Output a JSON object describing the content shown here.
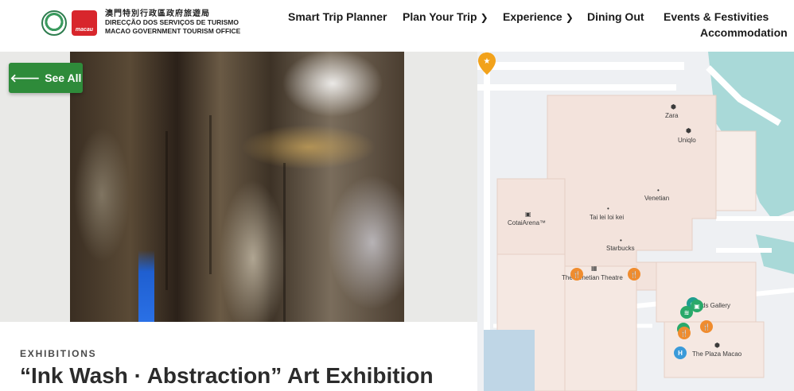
{
  "header": {
    "logo": {
      "zh_text": "澳門特別行政區政府旅遊局",
      "pt_text": "DIRECÇÃO DOS SERVIÇOS DE TURISMO",
      "en_text": "MACAO GOVERNMENT TOURISM OFFICE",
      "badge_text": "macau"
    },
    "nav": [
      {
        "label": "Smart Trip Planner",
        "has_chevron": false
      },
      {
        "label": "Plan Your Trip",
        "has_chevron": true
      },
      {
        "label": "Experience",
        "has_chevron": true
      },
      {
        "label": "Dining Out",
        "has_chevron": false
      },
      {
        "label": "Events & Festivities",
        "has_chevron": false
      },
      {
        "label": "Accommodation",
        "has_chevron": false
      }
    ]
  },
  "gallery": {
    "see_all_label": "See All",
    "see_all_icon": "arrow-left-icon",
    "expand_icon": "expand-icon"
  },
  "caption": {
    "category": "EXHIBITIONS",
    "title": "“Ink Wash · Abstraction” Art Exhibition"
  },
  "map": {
    "labels": {
      "zara": "Zara",
      "uniqlo": "Uniqlo",
      "venetian": "Venetian",
      "cotai_arena": "CotaiArena™",
      "tai_lei": "Tai lei loi kei",
      "starbucks": "Starbucks",
      "venetian_theatre": "The Venetian Theatre",
      "galleria": "ds Gallery",
      "plaza_macao": "The Plaza Macao"
    },
    "colors": {
      "water": "#a9d9d8",
      "building": "#f3e3dc",
      "road": "#ffffff",
      "food_poi": "#f08c2e",
      "pin": "#f2a21b"
    }
  },
  "colors": {
    "accent_green": "#2e8b3a"
  }
}
